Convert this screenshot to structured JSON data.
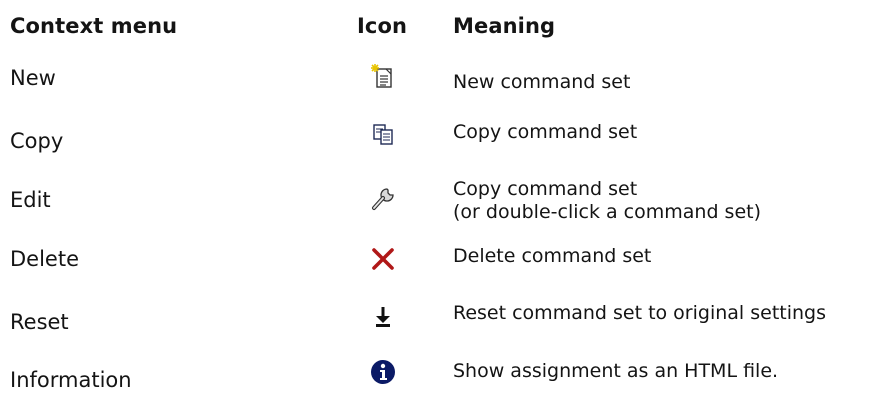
{
  "headers": {
    "context_menu": "Context menu",
    "icon": "Icon",
    "meaning": "Meaning"
  },
  "rows": [
    {
      "menu": "New",
      "icon": "new-document-icon",
      "meaning": "New command set"
    },
    {
      "menu": "Copy",
      "icon": "copy-icon",
      "meaning": "Copy command set"
    },
    {
      "menu": "Edit",
      "icon": "wrench-icon",
      "meaning": "Copy command set\n(or double-click a command set)"
    },
    {
      "menu": "Delete",
      "icon": "delete-x-icon",
      "meaning": "Delete command set"
    },
    {
      "menu": "Reset",
      "icon": "reset-arrow-icon",
      "meaning": "Reset command set to original settings"
    },
    {
      "menu": "Information",
      "icon": "info-icon",
      "meaning": "Show assignment as an HTML file."
    }
  ],
  "colors": {
    "text": "#141414",
    "delete_icon": "#b01818",
    "info_icon": "#0b1a66"
  }
}
